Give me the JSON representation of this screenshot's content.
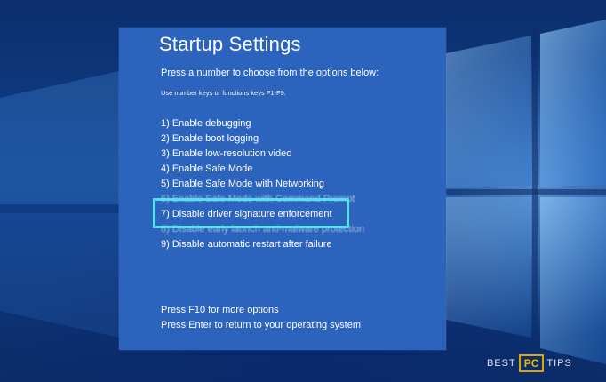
{
  "screen": {
    "title": "Startup Settings",
    "subtitle": "Press a number to choose from the options below:",
    "hint": "Use number keys or functions keys F1-F9.",
    "options": [
      {
        "label": "1) Enable debugging"
      },
      {
        "label": "2) Enable boot logging"
      },
      {
        "label": "3) Enable low-resolution video"
      },
      {
        "label": "4) Enable Safe Mode"
      },
      {
        "label": "5) Enable Safe Mode with Networking"
      },
      {
        "label": "6) Enable Safe Mode with Command Prompt"
      },
      {
        "label": "7) Disable driver signature enforcement"
      },
      {
        "label": "8) Disable early launch anti-malware protection"
      },
      {
        "label": "9) Disable automatic restart after failure"
      }
    ],
    "footer": {
      "more_options": "Press F10 for more options",
      "return": "Press Enter to return to your operating system"
    }
  },
  "highlight": {
    "selected_option": "7) Disable driver signature enforcement",
    "color": "#52e3ee"
  },
  "watermark": {
    "best": "BEST",
    "pc": "PC",
    "tips": "TIPS"
  },
  "colors": {
    "panel": "#2c63bd",
    "text": "#ffffff"
  }
}
